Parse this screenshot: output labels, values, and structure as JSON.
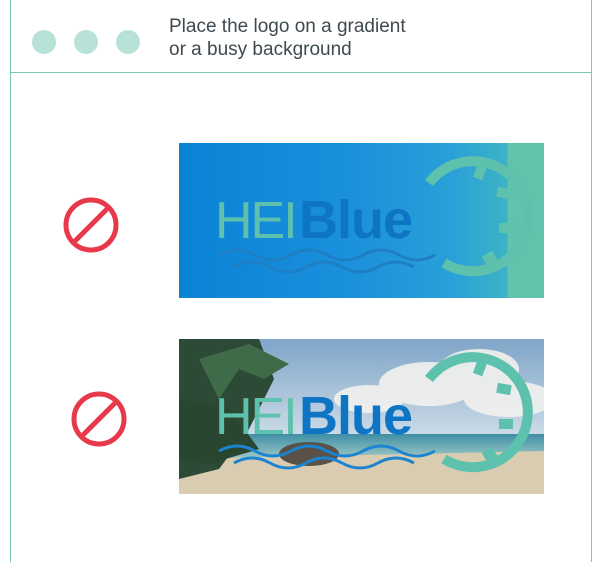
{
  "header": {
    "title": "Place the logo on a gradient\nor a busy background",
    "window_dots": [
      "dot",
      "dot",
      "dot"
    ]
  },
  "examples": [
    {
      "status_icon": "prohibited-icon",
      "background": "gradient",
      "logo": {
        "left_text": "HEI",
        "right_text": "Blue"
      }
    },
    {
      "status_icon": "prohibited-icon",
      "background": "beach-photo",
      "logo": {
        "left_text": "HEI",
        "right_text": "Blue"
      }
    }
  ],
  "colors": {
    "accent": "#79c9ba",
    "dot": "#b8e1d8",
    "prohibit": "#e8394b",
    "logo_teal": "#5ec1ad",
    "logo_blue": "#0d75c4"
  }
}
